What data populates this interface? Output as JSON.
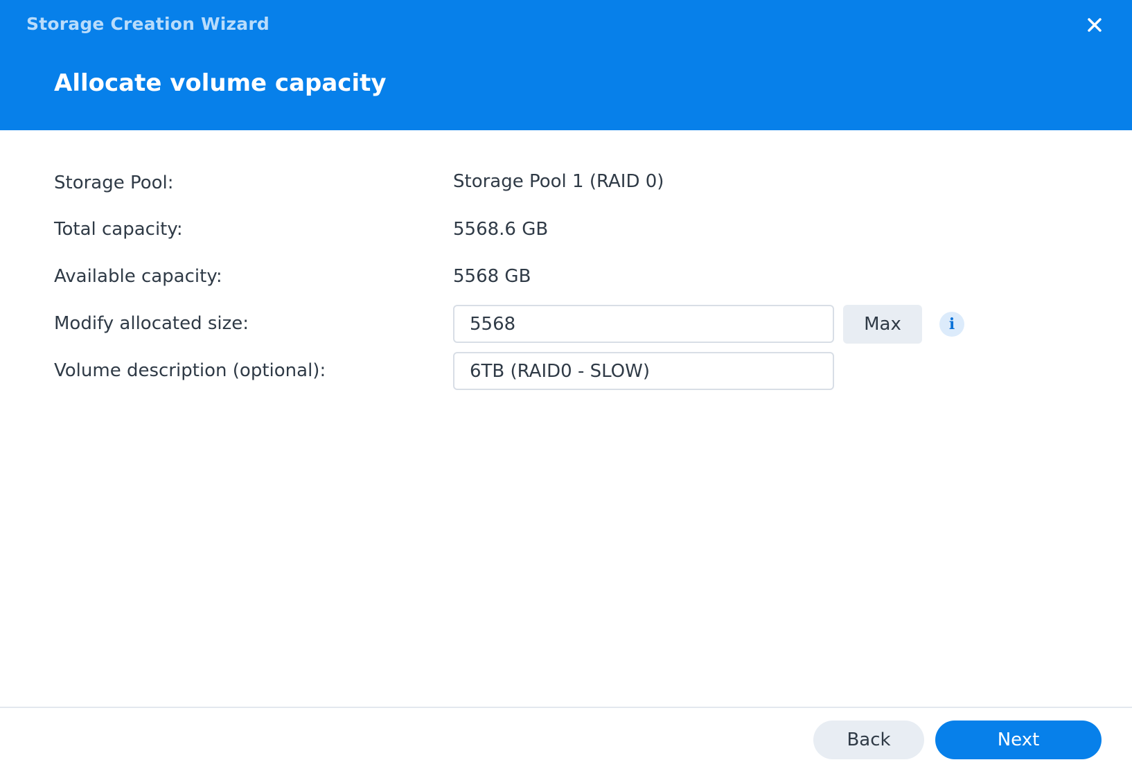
{
  "window": {
    "title": "Storage Creation Wizard",
    "close_icon": "close-icon"
  },
  "step": {
    "title": "Allocate volume capacity"
  },
  "form": {
    "storage_pool": {
      "label": "Storage Pool:",
      "value": "Storage Pool 1 (RAID 0)"
    },
    "total_capacity": {
      "label": "Total capacity:",
      "value": "5568.6 GB"
    },
    "available_capacity": {
      "label": "Available capacity:",
      "value": "5568 GB"
    },
    "allocated_size": {
      "label": "Modify allocated size:",
      "value": "5568",
      "max_label": "Max",
      "info_icon": "info-icon",
      "info_glyph": "i"
    },
    "volume_description": {
      "label": "Volume description (optional):",
      "value": "6TB (RAID0 - SLOW)"
    }
  },
  "footer": {
    "back_label": "Back",
    "next_label": "Next"
  },
  "colors": {
    "accent": "#0780ea",
    "header_subtitle": "#b9dcfb",
    "text": "#2f3a46",
    "secondary_button": "#e8edf3",
    "input_border": "#d8dee6"
  }
}
